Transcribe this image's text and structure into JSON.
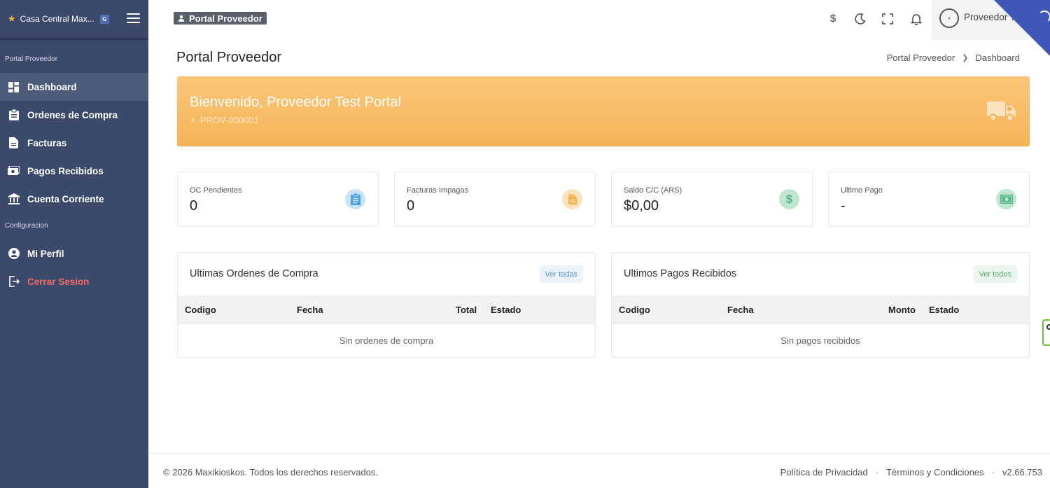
{
  "sidebar": {
    "brand": "Casa Central Max...",
    "brand_badge": "G",
    "section_portal": "Portal Proveedor",
    "section_config": "Configuracion",
    "items": [
      {
        "label": "Dashboard",
        "icon": "dashboard-icon"
      },
      {
        "label": "Ordenes de Compra",
        "icon": "clipboard-icon"
      },
      {
        "label": "Facturas",
        "icon": "document-icon"
      },
      {
        "label": "Pagos Recibidos",
        "icon": "money-icon"
      },
      {
        "label": "Cuenta Corriente",
        "icon": "bank-icon"
      }
    ],
    "config_items": [
      {
        "label": "Mi Perfil",
        "icon": "user-circle-icon"
      },
      {
        "label": "Cerrar Sesion",
        "icon": "logout-icon"
      }
    ]
  },
  "topbar": {
    "portal_badge": "Portal Proveedor",
    "user_name": "Proveedor Te"
  },
  "page": {
    "title": "Portal Proveedor",
    "breadcrumb": [
      "Portal Proveedor",
      "Dashboard"
    ]
  },
  "welcome": {
    "title": "Bienvenido, Proveedor Test Portal",
    "code": "PROV-000001"
  },
  "stats": [
    {
      "label": "OC Pendientes",
      "value": "0",
      "icon": "clipboard-icon",
      "color": "#4f9fe0"
    },
    {
      "label": "Facturas Impagas",
      "value": "0",
      "icon": "document-icon",
      "color": "#f5b656"
    },
    {
      "label": "Saldo C/C (ARS)",
      "value": "$0,00",
      "icon": "dollar-icon",
      "color": "#52b788"
    },
    {
      "label": "Ultimo Pago",
      "value": "-",
      "icon": "money-icon",
      "color": "#52b788"
    }
  ],
  "orders_panel": {
    "title": "Ultimas Ordenes de Compra",
    "button": "Ver todas",
    "columns": [
      "Codigo",
      "Fecha",
      "Total",
      "Estado"
    ],
    "empty": "Sin ordenes de compra"
  },
  "payments_panel": {
    "title": "Ultimos Pagos Recibidos",
    "button": "Ver todos",
    "columns": [
      "Codigo",
      "Fecha",
      "Monto",
      "Estado"
    ],
    "empty": "Sin pagos recibidos"
  },
  "footer": {
    "copyright": "© 2026 Maxikioskos. Todos los derechos reservados.",
    "privacy": "Política de Privacidad",
    "terms": "Términos y Condiciones",
    "version": "v2.66.753"
  }
}
